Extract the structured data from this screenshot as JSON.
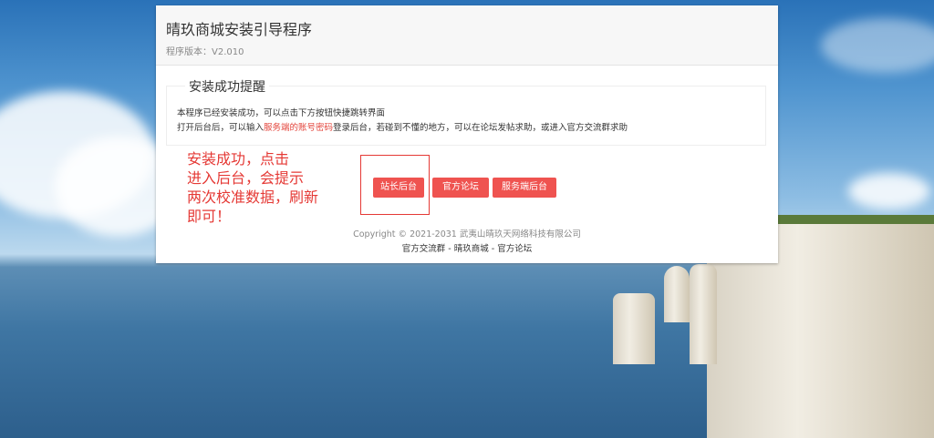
{
  "header": {
    "title": "晴玖商城安装引导程序",
    "version": "程序版本：V2.010"
  },
  "notice": {
    "legend": "安装成功提醒",
    "line1": "本程序已经安装成功，可以点击下方按钮快捷跳转界面",
    "line2_pre": "打开后台后，可以输入",
    "line2_link": "服务端的账号密码",
    "line2_post": "登录后台，若碰到不懂的地方，可以在论坛发帖求助，或进入官方交流群求助"
  },
  "buttons": {
    "admin": "站长后台",
    "forum": "官方论坛",
    "server_admin": "服务端后台"
  },
  "annotation": "安装成功，点击\n进入后台，会提示\n两次校准数据，刷新\n即可！",
  "footer": {
    "copyright": "Copyright © 2021-2031 武夷山晴玖天网络科技有限公司",
    "link_group": "官方交流群",
    "sep1": " - ",
    "link_mall": "晴玖商城",
    "sep2": " - ",
    "link_forum": "官方论坛"
  },
  "colors": {
    "button": "#ef5350",
    "annotation": "#e53935",
    "link": "#e3443b"
  }
}
